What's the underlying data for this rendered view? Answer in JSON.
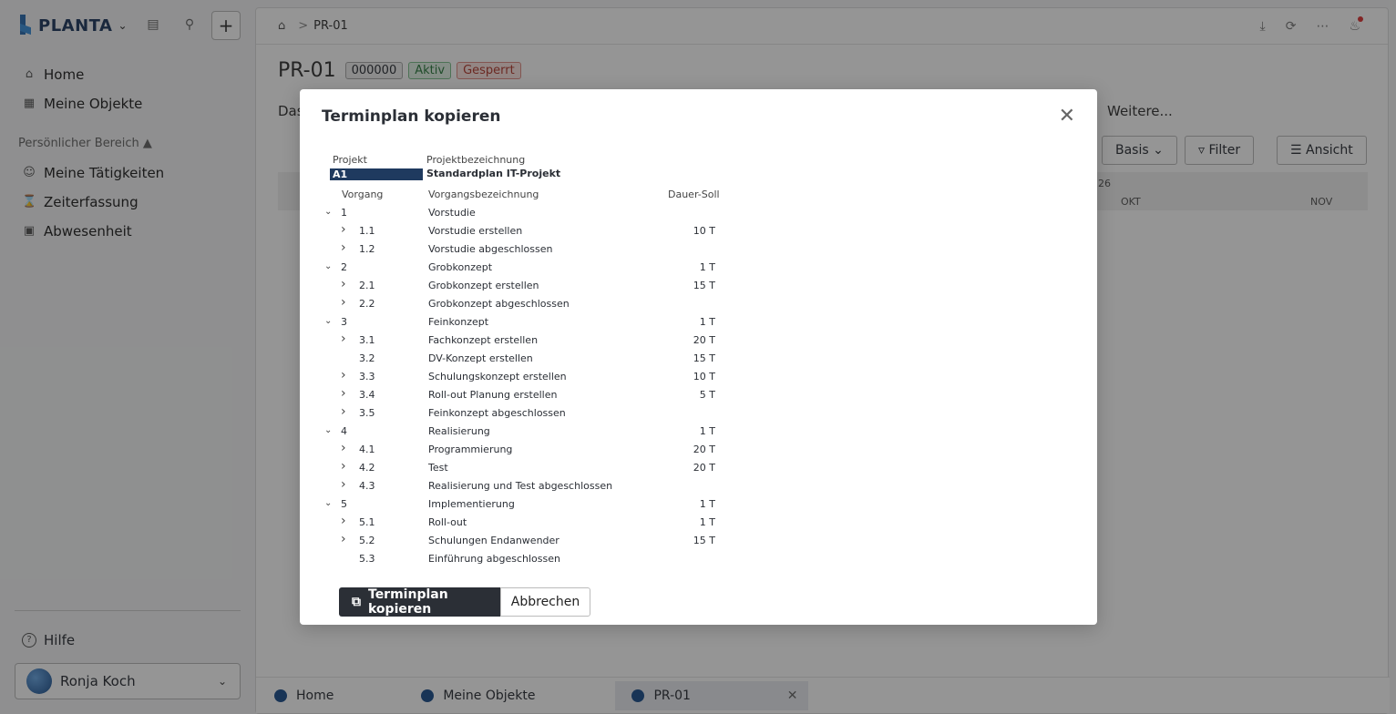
{
  "sidebar": {
    "logo": "PLANTA",
    "nav": [
      {
        "label": "Home",
        "icon": "home-icon"
      },
      {
        "label": "Meine Objekte",
        "icon": "grid-icon"
      }
    ],
    "section_label": "Persönlicher Bereich",
    "personal": [
      {
        "label": "Meine Tätigkeiten",
        "icon": "user-icon"
      },
      {
        "label": "Zeiterfassung",
        "icon": "hourglass-icon"
      },
      {
        "label": "Abwesenheit",
        "icon": "calendar-icon"
      }
    ],
    "help": "Hilfe",
    "user": "Ronja Koch"
  },
  "main": {
    "breadcrumb": "PR-01",
    "title": "PR-01",
    "tags": [
      "000000",
      "Aktiv",
      "Gesperrt"
    ],
    "tab_first": "Das",
    "tab_more": "Weitere...",
    "tools": {
      "basis": "Basis",
      "filter": "Filter",
      "ansicht": "Ansicht"
    },
    "gantt": {
      "year": "26",
      "m1": "OKT",
      "m2": "NOV"
    },
    "bottom_tabs": [
      "Home",
      "Meine Objekte",
      "PR-01"
    ]
  },
  "dialog": {
    "title": "Terminplan kopieren",
    "hdr_projekt": "Projekt",
    "hdr_projektbez": "Projektbezeichnung",
    "project_id": "A1",
    "project_name": "Standardplan IT-Projekt",
    "hdr_vorgang": "Vorgang",
    "hdr_vorgangsbez": "Vorgangsbezeichnung",
    "hdr_dauer": "Dauer-Soll",
    "rows": [
      {
        "num": "1",
        "desc": "Vorstudie",
        "dur": "",
        "level": 0,
        "chev": "down"
      },
      {
        "num": "1.1",
        "desc": "Vorstudie erstellen",
        "dur": "10 T",
        "level": 1,
        "chev": "right"
      },
      {
        "num": "1.2",
        "desc": "Vorstudie abgeschlossen",
        "dur": "",
        "level": 1,
        "chev": "right"
      },
      {
        "num": "2",
        "desc": "Grobkonzept",
        "dur": "1 T",
        "level": 0,
        "chev": "down"
      },
      {
        "num": "2.1",
        "desc": "Grobkonzept erstellen",
        "dur": "15 T",
        "level": 1,
        "chev": "right"
      },
      {
        "num": "2.2",
        "desc": "Grobkonzept abgeschlossen",
        "dur": "",
        "level": 1,
        "chev": "right"
      },
      {
        "num": "3",
        "desc": "Feinkonzept",
        "dur": "1 T",
        "level": 0,
        "chev": "down"
      },
      {
        "num": "3.1",
        "desc": "Fachkonzept erstellen",
        "dur": "20 T",
        "level": 1,
        "chev": "right"
      },
      {
        "num": "3.2",
        "desc": "DV-Konzept erstellen",
        "dur": "15 T",
        "level": 1,
        "chev": ""
      },
      {
        "num": "3.3",
        "desc": "Schulungskonzept erstellen",
        "dur": "10 T",
        "level": 1,
        "chev": "right"
      },
      {
        "num": "3.4",
        "desc": "Roll-out Planung erstellen",
        "dur": "5 T",
        "level": 1,
        "chev": "right"
      },
      {
        "num": "3.5",
        "desc": "Feinkonzept abgeschlossen",
        "dur": "",
        "level": 1,
        "chev": "right"
      },
      {
        "num": "4",
        "desc": "Realisierung",
        "dur": "1 T",
        "level": 0,
        "chev": "down"
      },
      {
        "num": "4.1",
        "desc": "Programmierung",
        "dur": "20 T",
        "level": 1,
        "chev": "right"
      },
      {
        "num": "4.2",
        "desc": "Test",
        "dur": "20 T",
        "level": 1,
        "chev": "right"
      },
      {
        "num": "4.3",
        "desc": "Realisierung und Test abgeschlossen",
        "dur": "",
        "level": 1,
        "chev": "right"
      },
      {
        "num": "5",
        "desc": "Implementierung",
        "dur": "1 T",
        "level": 0,
        "chev": "down"
      },
      {
        "num": "5.1",
        "desc": "Roll-out",
        "dur": "1 T",
        "level": 1,
        "chev": "right"
      },
      {
        "num": "5.2",
        "desc": "Schulungen Endanwender",
        "dur": "15 T",
        "level": 1,
        "chev": "right"
      },
      {
        "num": "5.3",
        "desc": "Einführung abgeschlossen",
        "dur": "",
        "level": 1,
        "chev": ""
      }
    ],
    "btn_copy": "Terminplan kopieren",
    "btn_cancel": "Abbrechen"
  }
}
